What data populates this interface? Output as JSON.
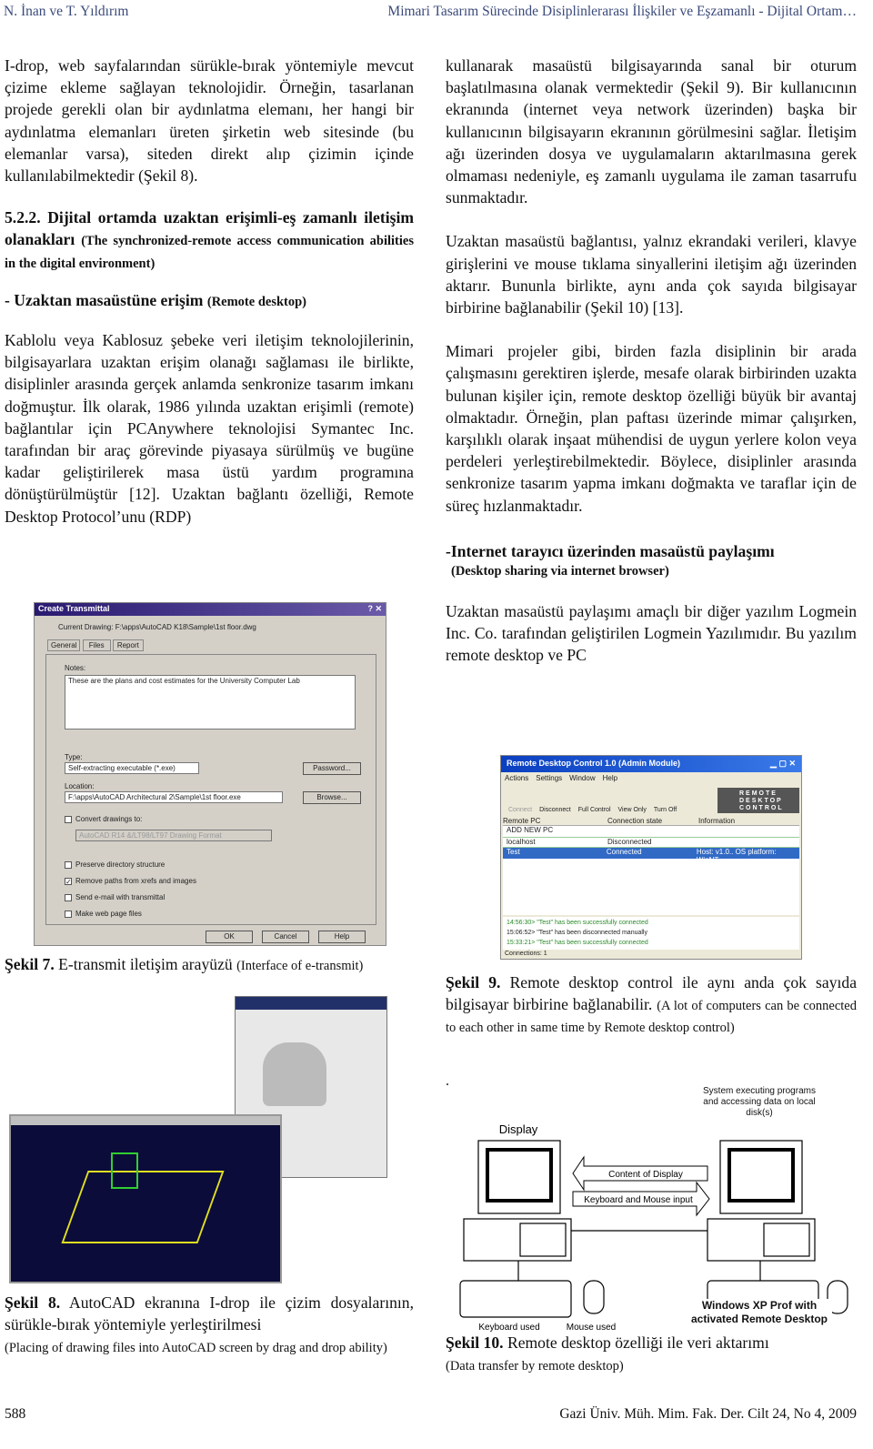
{
  "header": {
    "left": "N. İnan ve T. Yıldırım",
    "right": "Mimari Tasarım Sürecinde Disiplinlerarası İlişkiler ve Eşzamanlı - Dijital Ortam…"
  },
  "left": {
    "p1": "I-drop, web sayfalarından sürükle-bırak yöntemiyle mevcut çizime ekleme sağlayan teknolojidir. Örneğin, tasarlanan projede gerekli olan bir aydınlatma elemanı, her hangi bir aydınlatma elemanları üreten şirketin web sitesinde (bu elemanlar varsa), siteden direkt alıp çizimin içinde kullanılabilmektedir (Şekil 8).",
    "h1": "5.2.2. Dijital ortamda uzaktan erişimli-eş zamanlı iletişim olanakları",
    "h1_en": "(The synchronized-remote access communication abilities in the digital environment)",
    "h2": "- Uzaktan masaüstüne erişim",
    "h2_en": "(Remote desktop)",
    "p2": "Kablolu veya Kablosuz şebeke veri iletişim teknolojilerinin, bilgisayarlara uzaktan erişim olanağı sağlaması ile birlikte, disiplinler arasında gerçek anlamda senkronize tasarım imkanı doğmuştur. İlk olarak, 1986 yılında uzaktan erişimli (remote) bağlantılar için PCAnywhere teknolojisi Symantec Inc. tarafından bir araç görevinde piyasaya sürülmüş ve bugüne kadar geliştirilerek masa üstü yardım programına dönüştürülmüştür [12]. Uzaktan bağlantı özelliği, Remote Desktop Protocol’unu (RDP)",
    "fig7": {
      "label": "Şekil 7.",
      "title": "E-transmit iletişim arayüzü",
      "en": "(Interface of e-transmit)"
    },
    "fig8": {
      "label": "Şekil 8.",
      "title": "AutoCAD ekranına I-drop ile çizim dosyalarının, sürükle-bırak yöntemiyle yerleştirilmesi",
      "en": "(Placing of drawing files into AutoCAD screen by drag and drop ability)"
    }
  },
  "dialog7": {
    "title": "Create Transmittal",
    "current": "Current Drawing: F:\\apps\\AutoCAD K18\\Sample\\1st floor.dwg",
    "tabs": [
      "General",
      "Files",
      "Report"
    ],
    "notes_label": "Notes:",
    "notes": "These are the plans and cost estimates for the University Computer Lab",
    "type_label": "Type:",
    "type_value": "Self-extracting executable (*.exe)",
    "password": "Password...",
    "location_label": "Location:",
    "location_value": "F:\\apps\\AutoCAD Architectural 2\\Sample\\1st floor.exe",
    "browse": "Browse...",
    "convert": "Convert drawings to:",
    "convert_value": "AutoCAD R14 &/LT98/LT97 Drawing Format",
    "options": [
      {
        "label": "Preserve directory structure",
        "checked": false
      },
      {
        "label": "Remove paths from xrefs and images",
        "checked": true
      },
      {
        "label": "Send e-mail with transmittal",
        "checked": false
      },
      {
        "label": "Make web page files",
        "checked": false
      }
    ],
    "ok": "OK",
    "cancel": "Cancel",
    "help": "Help"
  },
  "right": {
    "p1": "kullanarak masaüstü bilgisayarında sanal bir oturum başlatılmasına olanak vermektedir (Şekil 9). Bir kullanıcının ekranında (internet veya network üzerinden) başka bir kullanıcının bilgisayarın ekranının görülmesini sağlar. İletişim ağı üzerinden dosya ve uygulamaların aktarılmasına gerek olmaması nedeniyle, eş zamanlı uygulama ile zaman tasarrufu sunmaktadır.",
    "p2": "Uzaktan masaüstü bağlantısı, yalnız ekrandaki verileri, klavye girişlerini ve mouse tıklama sinyallerini iletişim ağı üzerinden aktarır. Bununla birlikte, aynı anda çok sayıda bilgisayar birbirine bağlanabilir (Şekil 10) [13].",
    "p3": "Mimari projeler gibi, birden fazla disiplinin bir arada çalışmasını gerektiren işlerde, mesafe olarak birbirinden uzakta bulunan kişiler için, remote desktop özelliği büyük bir avantaj olmaktadır. Örneğin, plan paftası üzerinde mimar çalışırken, karşılıklı olarak inşaat mühendisi de uygun yerlere kolon veya perdeleri yerleştirebilmektedir. Böylece, disiplinler arasında senkronize tasarım yapma imkanı doğmakta ve taraflar için de süreç hızlanmaktadır.",
    "h1": "-Internet tarayıcı üzerinden masaüstü paylaşımı",
    "h1_en": "(Desktop sharing via internet browser)",
    "p4": "Uzaktan masaüstü paylaşımı amaçlı bir diğer yazılım Logmein Inc. Co. tarafından geliştirilen Logmein Yazılımıdır. Bu yazılım remote desktop ve PC",
    "fig9": {
      "label": "Şekil 9.",
      "title": "Remote desktop control ile aynı anda çok sayıda bilgisayar birbirine bağlanabilir.",
      "en": "(A lot of computers can be connected to each other in same time by Remote desktop control)"
    },
    "dot": ".",
    "fig10": {
      "label": "Şekil 10.",
      "title": "Remote desktop özelliği ile veri aktarımı",
      "en": "(Data transfer by remote desktop)"
    }
  },
  "rdc": {
    "title": "Remote Desktop Control 1.0 (Admin Module)",
    "menu": [
      "Actions",
      "Settings",
      "Window",
      "Help"
    ],
    "tools": [
      "Connect",
      "Disconnect",
      "Full Control",
      "View Only",
      "Turn Off"
    ],
    "logo": "REMOTE DESKTOP CONTROL",
    "columns": [
      "Remote PC",
      "Connection state",
      "Information"
    ],
    "rows": [
      {
        "pc": "ADD NEW PC",
        "state": "",
        "info": ""
      },
      {
        "pc": "localhost",
        "state": "Disconnected",
        "info": ""
      },
      {
        "pc": "Test",
        "state": "Connected",
        "info": "Host: v1.0.. OS platform: WinNT"
      }
    ],
    "log": [
      "14:56:30> \"Test\" has been successfully connected",
      "15:06:52> \"Test\" has been disconnected manually",
      "15:33:21> \"Test\" has been successfully connected"
    ],
    "status": "Connections: 1"
  },
  "diagram10": {
    "display": "Display",
    "system": "System executing programs and accessing data on local disk(s)",
    "content": "Content of Display",
    "input": "Keyboard and Mouse input",
    "keyboard": "Keyboard used",
    "mouse": "Mouse used",
    "winxp": "Windows XP Prof with activated Remote Desktop"
  },
  "footer": {
    "page": "588",
    "journal": "Gazi Üniv. Müh. Mim. Fak. Der. Cilt 24, No 4, 2009"
  }
}
